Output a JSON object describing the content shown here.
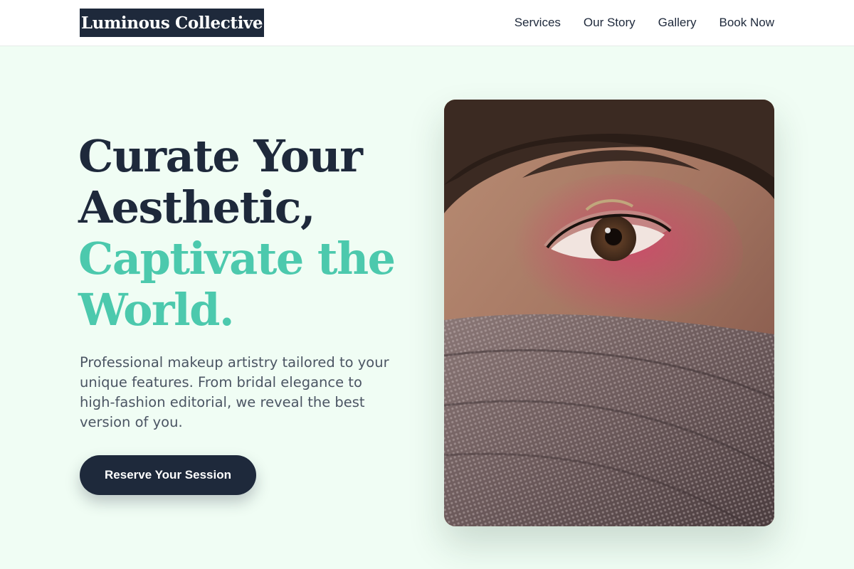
{
  "header": {
    "logo_text": "Luminous Collective",
    "nav": [
      "Services",
      "Our Story",
      "Gallery",
      "Book Now"
    ]
  },
  "hero": {
    "title_lines": [
      "Curate Your",
      "Aesthetic,",
      "Captivate the",
      "World."
    ],
    "description": "Professional makeup artistry tailored to your unique features. From bridal elegance to high-fashion editorial, we reveal the best version of you.",
    "cta_label": "Reserve Your Session"
  },
  "colors": {
    "background": "#f0fdf4",
    "navy": "#1e293b",
    "accent": "#4cc9ad"
  }
}
